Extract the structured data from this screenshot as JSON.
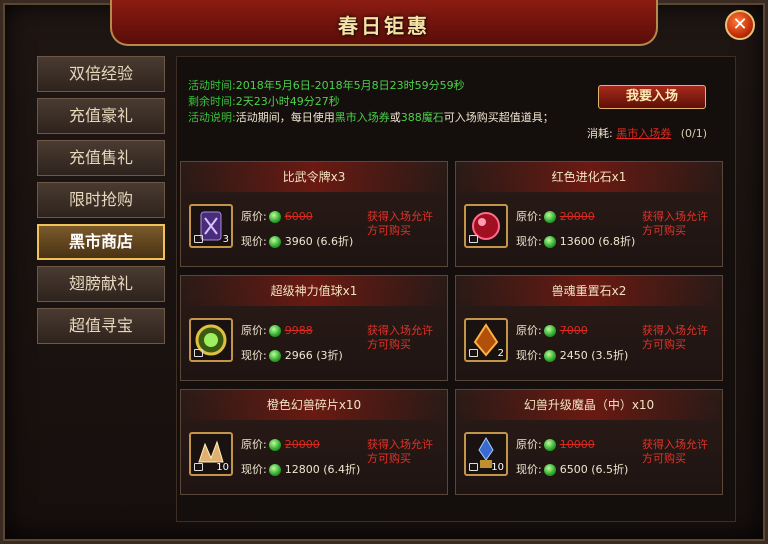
{
  "title": "春日钜惠",
  "sidebar": {
    "items": [
      {
        "label": "双倍经验"
      },
      {
        "label": "充值豪礼"
      },
      {
        "label": "充值售礼"
      },
      {
        "label": "限时抢购"
      },
      {
        "label": "黑市商店",
        "active": true
      },
      {
        "label": "翅膀献礼"
      },
      {
        "label": "超值寻宝"
      }
    ]
  },
  "info": {
    "time_label": "活动时间:",
    "time_value": "2018年5月6日-2018年5月8日23时59分59秒",
    "remain_label": "剩余时间:",
    "remain_value": "2天23小时49分27秒",
    "desc_label": "活动说明:",
    "desc_pre": "活动期间，每日使用",
    "desc_ticket": "黑市入场券",
    "desc_or": "或",
    "desc_stone": "388魔石",
    "desc_post": "可入场购买超值道具；"
  },
  "enter_button": "我要入场",
  "consume": {
    "label": "消耗:",
    "item": "黑市入场券",
    "count": "(0/1)"
  },
  "price_labels": {
    "orig": "原价:",
    "now": "现价:"
  },
  "items": [
    {
      "name": "比武令牌x3",
      "count": "3",
      "orig": "6000",
      "now": "3960 (6.6折)",
      "note": "获得入场允许方可购买",
      "icon": "token-icon"
    },
    {
      "name": "红色进化石x1",
      "count": "",
      "orig": "20000",
      "now": "13600 (6.8折)",
      "note": "获得入场允许方可购买",
      "icon": "red-stone-icon"
    },
    {
      "name": "超级神力值球x1",
      "count": "",
      "orig": "9988",
      "now": "2966 (3折)",
      "note": "获得入场允许方可购买",
      "icon": "orb-icon"
    },
    {
      "name": "兽魂重置石x2",
      "count": "2",
      "orig": "7000",
      "now": "2450 (3.5折)",
      "note": "获得入场允许方可购买",
      "icon": "beast-stone-icon"
    },
    {
      "name": "橙色幻兽碎片x10",
      "count": "10",
      "orig": "20000",
      "now": "12800 (6.4折)",
      "note": "获得入场允许方可购买",
      "icon": "fragment-icon"
    },
    {
      "name": "幻兽升级魔晶（中）x10",
      "count": "10",
      "orig": "10000",
      "now": "6500 (6.5折)",
      "note": "获得入场允许方可购买",
      "icon": "crystal-icon"
    }
  ]
}
